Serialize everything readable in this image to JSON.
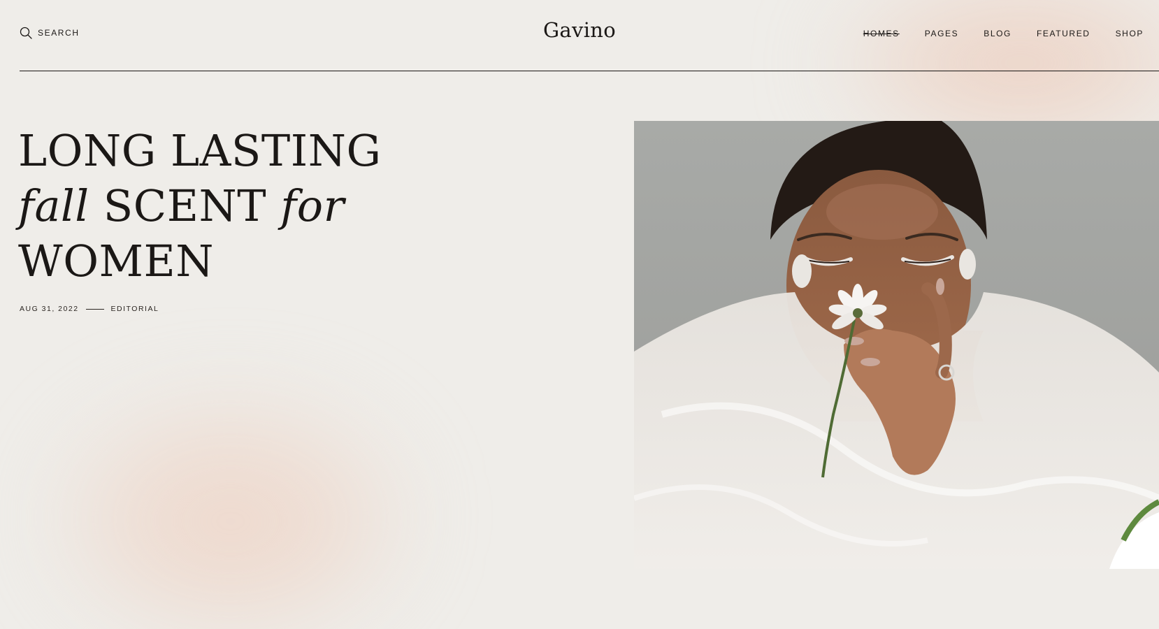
{
  "header": {
    "search_label": "SEARCH",
    "search_icon": "search-icon",
    "logo": "Gavino",
    "nav": [
      {
        "label": "HOMES",
        "active": true
      },
      {
        "label": "PAGES",
        "active": false
      },
      {
        "label": "BLOG",
        "active": false
      },
      {
        "label": "FEATURED",
        "active": false
      },
      {
        "label": "SHOP",
        "active": false
      }
    ]
  },
  "hero": {
    "title_line1": "LONG LASTING",
    "title_line2_italic_a": "fall",
    "title_line2_regular": "SCENT",
    "title_line2_italic_b": "for",
    "title_line3": "WOMEN",
    "date": "AUG 31, 2022",
    "category": "EDITORIAL"
  },
  "colors": {
    "background": "#efede9",
    "text": "#1b1816",
    "accent_blush": "#ecd2c4"
  }
}
